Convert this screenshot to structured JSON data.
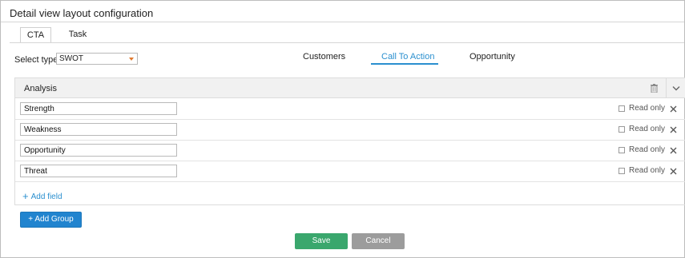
{
  "window": {
    "title": "Detail view layout configuration"
  },
  "tabs": [
    {
      "label": "CTA",
      "active": true
    },
    {
      "label": "Task",
      "active": false
    }
  ],
  "select_type": {
    "label": "Select type:",
    "value": "SWOT"
  },
  "subnav": [
    {
      "label": "Customers",
      "active": false
    },
    {
      "label": "Call To Action",
      "active": true
    },
    {
      "label": "Opportunity",
      "active": false
    }
  ],
  "group": {
    "title": "Analysis",
    "fields": [
      {
        "value": "Strength",
        "read_only_label": "Read only",
        "read_only": false
      },
      {
        "value": "Weakness",
        "read_only_label": "Read only",
        "read_only": false
      },
      {
        "value": "Opportunity",
        "read_only_label": "Read only",
        "read_only": false
      },
      {
        "value": "Threat",
        "read_only_label": "Read only",
        "read_only": false
      }
    ],
    "add_field_label": "Add field"
  },
  "buttons": {
    "add_group": "+ Add Group",
    "save": "Save",
    "cancel": "Cancel"
  },
  "colors": {
    "accent": "#2a8fcf",
    "primary_button": "#2184cf",
    "save": "#3aa76d",
    "cancel": "#9c9c9c",
    "caret": "#e07a2f"
  },
  "icons": {
    "trash": "trash-icon",
    "collapse": "chevron-down-icon",
    "remove": "close-icon",
    "add": "plus-icon"
  }
}
